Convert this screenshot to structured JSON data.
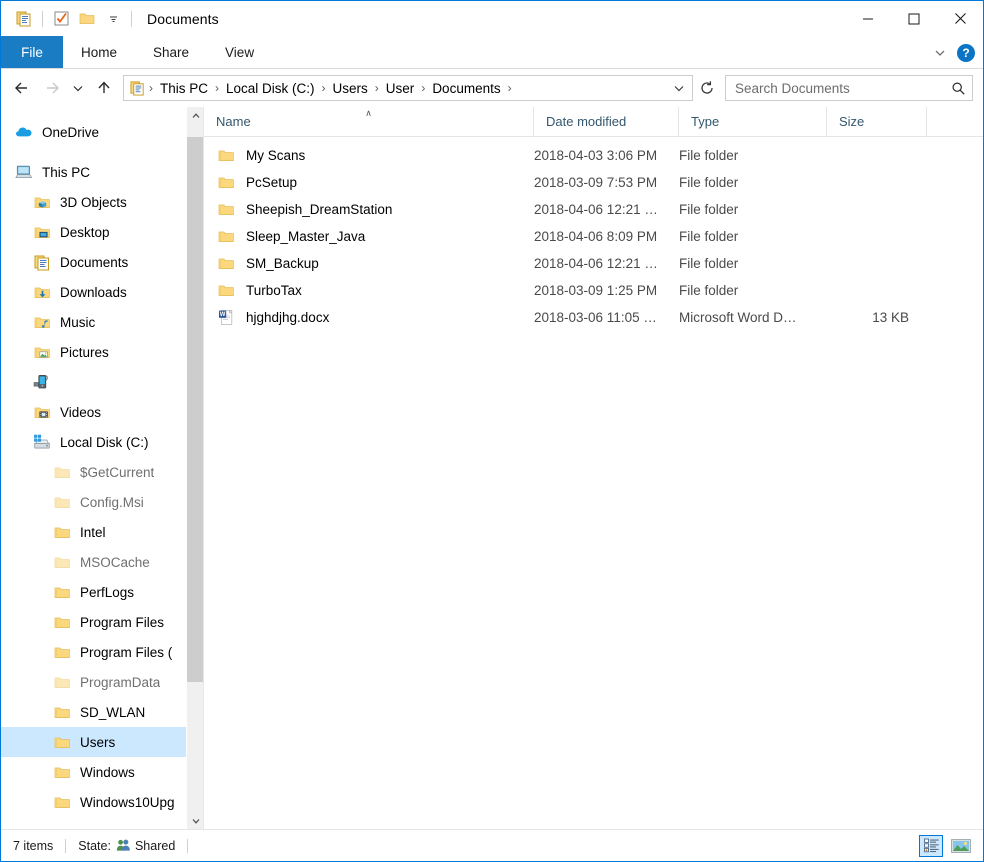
{
  "window": {
    "title": "Documents",
    "quick_access": [
      {
        "name": "properties-icon",
        "label": "Properties"
      },
      {
        "name": "new-folder-check-icon",
        "label": "Check"
      },
      {
        "name": "new-folder-icon",
        "label": "New folder"
      },
      {
        "name": "customize-qat-chevron-icon",
        "label": "Customize Quick Access Toolbar"
      }
    ],
    "controls": {
      "minimize": "─",
      "maximize": "□",
      "close": "✕"
    }
  },
  "ribbon": {
    "tabs": [
      {
        "id": "file",
        "label": "File"
      },
      {
        "id": "home",
        "label": "Home"
      },
      {
        "id": "share",
        "label": "Share"
      },
      {
        "id": "view",
        "label": "View"
      }
    ],
    "expand_label": "∨",
    "help_label": "?",
    "accent_color": "#1a7dc4"
  },
  "navigation": {
    "back_title": "Back",
    "forward_title": "Forward",
    "recent_title": "Recent locations",
    "up_title": "Up",
    "refresh_title": "Refresh",
    "breadcrumbs": [
      "This PC",
      "Local Disk (C:)",
      "Users",
      "User",
      "Documents"
    ],
    "breadcrumb_separator": "›",
    "dropdown_label": "∨"
  },
  "search": {
    "placeholder": "Search Documents",
    "value": "",
    "icon": "search-icon"
  },
  "sidebar": {
    "items": [
      {
        "label": "OneDrive",
        "icon": "onedrive-icon",
        "indent": "lvl0",
        "dim": false,
        "selected": false
      },
      {
        "label": "This PC",
        "icon": "thispc-icon",
        "indent": "lvl0",
        "dim": false,
        "selected": false,
        "gap_before": true
      },
      {
        "label": "3D Objects",
        "icon": "folder-3dobjects-icon",
        "indent": "lvl1",
        "dim": false,
        "selected": false
      },
      {
        "label": "Desktop",
        "icon": "folder-desktop-icon",
        "indent": "lvl1",
        "dim": false,
        "selected": false
      },
      {
        "label": "Documents",
        "icon": "folder-documents-icon",
        "indent": "lvl1",
        "dim": false,
        "selected": false
      },
      {
        "label": "Downloads",
        "icon": "folder-downloads-icon",
        "indent": "lvl1",
        "dim": false,
        "selected": false
      },
      {
        "label": "Music",
        "icon": "folder-music-icon",
        "indent": "lvl1",
        "dim": false,
        "selected": false
      },
      {
        "label": "Pictures",
        "icon": "folder-pictures-icon",
        "indent": "lvl1",
        "dim": false,
        "selected": false
      },
      {
        "label": "",
        "icon": "portable-device-icon",
        "indent": "lvl1",
        "dim": false,
        "selected": false
      },
      {
        "label": "Videos",
        "icon": "folder-videos-icon",
        "indent": "lvl1",
        "dim": false,
        "selected": false
      },
      {
        "label": "Local Disk (C:)",
        "icon": "local-disk-icon",
        "indent": "lvl1",
        "dim": false,
        "selected": false
      },
      {
        "label": "$GetCurrent",
        "icon": "folder-icon",
        "indent": "lvl2",
        "dim": true,
        "selected": false
      },
      {
        "label": "Config.Msi",
        "icon": "folder-icon",
        "indent": "lvl2",
        "dim": true,
        "selected": false
      },
      {
        "label": "Intel",
        "icon": "folder-icon",
        "indent": "lvl2",
        "dim": false,
        "selected": false
      },
      {
        "label": "MSOCache",
        "icon": "folder-icon",
        "indent": "lvl2",
        "dim": true,
        "selected": false
      },
      {
        "label": "PerfLogs",
        "icon": "folder-icon",
        "indent": "lvl2",
        "dim": false,
        "selected": false
      },
      {
        "label": "Program Files",
        "icon": "folder-icon",
        "indent": "lvl2",
        "dim": false,
        "selected": false
      },
      {
        "label": "Program Files (",
        "icon": "folder-icon",
        "indent": "lvl2",
        "dim": false,
        "selected": false
      },
      {
        "label": "ProgramData",
        "icon": "folder-icon",
        "indent": "lvl2",
        "dim": true,
        "selected": false
      },
      {
        "label": "SD_WLAN",
        "icon": "folder-icon",
        "indent": "lvl2",
        "dim": false,
        "selected": false
      },
      {
        "label": "Users",
        "icon": "folder-icon",
        "indent": "lvl2",
        "dim": false,
        "selected": true
      },
      {
        "label": "Windows",
        "icon": "folder-icon",
        "indent": "lvl2",
        "dim": false,
        "selected": false
      },
      {
        "label": "Windows10Upg",
        "icon": "folder-icon",
        "indent": "lvl2",
        "dim": false,
        "selected": false
      }
    ],
    "scroll_up_label": "∧",
    "scroll_down_label": "∨"
  },
  "filelist": {
    "columns": [
      {
        "key": "name",
        "label": "Name",
        "sorted": true,
        "sort_caret": "∧"
      },
      {
        "key": "date",
        "label": "Date modified",
        "sorted": false,
        "sort_caret": ""
      },
      {
        "key": "type",
        "label": "Type",
        "sorted": false,
        "sort_caret": ""
      },
      {
        "key": "size",
        "label": "Size",
        "sorted": false,
        "sort_caret": ""
      }
    ],
    "rows": [
      {
        "name": "My Scans",
        "date": "2018-04-03 3:06 PM",
        "type": "File folder",
        "size": "",
        "icon": "folder-icon"
      },
      {
        "name": "PcSetup",
        "date": "2018-03-09 7:53 PM",
        "type": "File folder",
        "size": "",
        "icon": "folder-icon"
      },
      {
        "name": "Sheepish_DreamStation",
        "date": "2018-04-06 12:21 …",
        "type": "File folder",
        "size": "",
        "icon": "folder-icon"
      },
      {
        "name": "Sleep_Master_Java",
        "date": "2018-04-06 8:09 PM",
        "type": "File folder",
        "size": "",
        "icon": "folder-icon"
      },
      {
        "name": "SM_Backup",
        "date": "2018-04-06 12:21 …",
        "type": "File folder",
        "size": "",
        "icon": "folder-icon"
      },
      {
        "name": "TurboTax",
        "date": "2018-03-09 1:25 PM",
        "type": "File folder",
        "size": "",
        "icon": "folder-icon"
      },
      {
        "name": "hjghdjhg.docx",
        "date": "2018-03-06 11:05 …",
        "type": "Microsoft Word D…",
        "size": "13 KB",
        "icon": "word-document-icon"
      }
    ]
  },
  "statusbar": {
    "item_count": "7 items",
    "state_label": "State:",
    "state_value": "Shared",
    "state_icon": "shared-people-icon",
    "views": [
      {
        "name": "details-view-button",
        "label": "Details view",
        "active": true
      },
      {
        "name": "large-icons-view-button",
        "label": "Large icons view",
        "active": false
      }
    ]
  }
}
